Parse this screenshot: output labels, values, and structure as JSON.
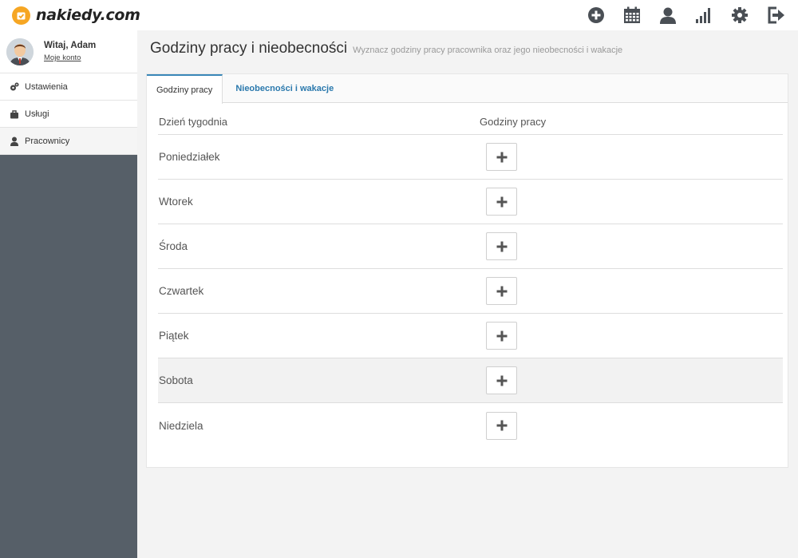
{
  "brand": {
    "name": "nakiedy.com",
    "accent": "#f6a623"
  },
  "top_icons": [
    "add-icon",
    "calendar-icon",
    "user-icon",
    "stats-icon",
    "settings-icon",
    "logout-icon"
  ],
  "user": {
    "greeting": "Witaj, Adam",
    "account_link": "Moje konto"
  },
  "sidebar": {
    "items": [
      {
        "label": "Ustawienia",
        "icon": "cogs-icon"
      },
      {
        "label": "Usługi",
        "icon": "briefcase-icon"
      },
      {
        "label": "Pracownicy",
        "icon": "user-icon",
        "active": true
      }
    ]
  },
  "page": {
    "title": "Godziny pracy i nieobecności",
    "subtitle": "Wyznacz godziny pracy pracownika oraz jego nieobecności i wakacje"
  },
  "tabs": [
    {
      "label": "Godziny pracy",
      "active": true
    },
    {
      "label": "Nieobecności i wakacje",
      "active": false
    }
  ],
  "table": {
    "headers": {
      "day": "Dzień tygodnia",
      "hours": "Godziny pracy"
    },
    "rows": [
      {
        "day": "Poniedziałek"
      },
      {
        "day": "Wtorek"
      },
      {
        "day": "Środa"
      },
      {
        "day": "Czwartek"
      },
      {
        "day": "Piątek"
      },
      {
        "day": "Sobota",
        "highlighted": true
      },
      {
        "day": "Niedziela"
      }
    ]
  },
  "colors": {
    "sidebar_bg": "#565f68",
    "tab_accent": "#3a87b8",
    "link": "#2b79ad",
    "icon": "#4a4f55"
  }
}
